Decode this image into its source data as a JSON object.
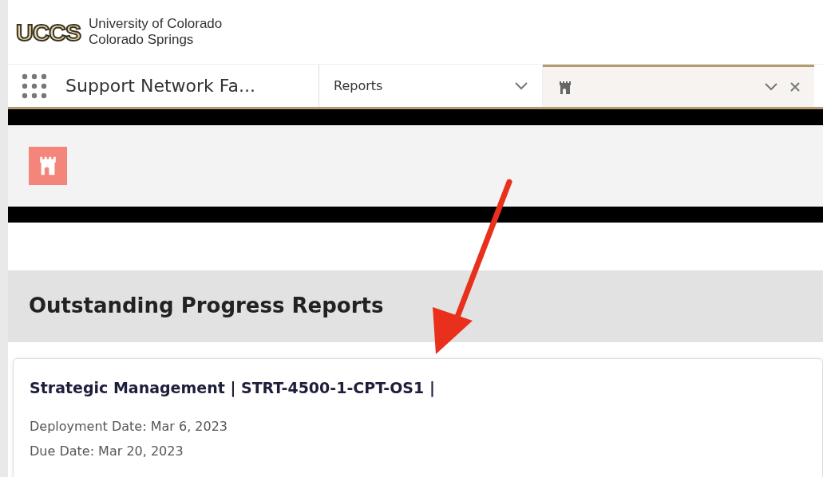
{
  "header": {
    "logo": "UCCS",
    "org_lines": [
      "University of Colorado",
      "Colorado Springs"
    ]
  },
  "app_name": "Support Network Fa...",
  "tabs": [
    {
      "kind": "text",
      "label": "Reports",
      "selected": false
    },
    {
      "kind": "icon",
      "selected": true
    }
  ],
  "section_title": "Outstanding Progress Reports",
  "reports": [
    {
      "title": "Strategic Management | STRT-4500-1-CPT-OS1 |",
      "lines": [
        "Deployment Date: Mar 6, 2023",
        "Due Date: Mar 20, 2023"
      ]
    }
  ]
}
